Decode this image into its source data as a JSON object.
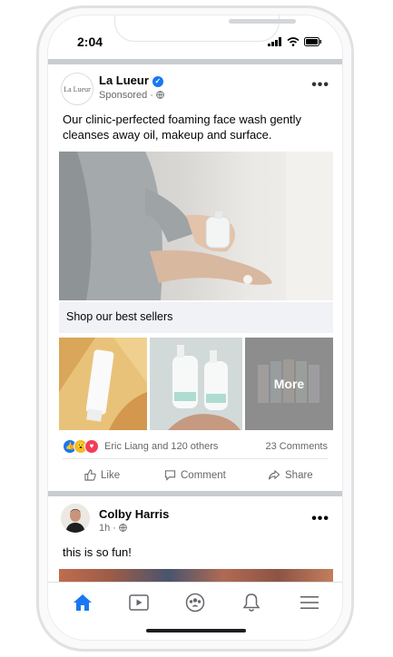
{
  "status": {
    "time": "2:04"
  },
  "post": {
    "page_name": "La Lueur",
    "logo_text": "La Lueur",
    "sponsored_label": "Sponsored",
    "text": "Our clinic-perfected foaming face wash gently cleanses away oil, makeup and surface.",
    "banner": "Shop our best sellers",
    "more_label": "More",
    "reactions_text": "Eric Liang and 120 others",
    "comments_text": "23 Comments",
    "actions": {
      "like": "Like",
      "comment": "Comment",
      "share": "Share"
    }
  },
  "post2": {
    "author": "Colby Harris",
    "time": "1h",
    "text": "this is so fun!"
  },
  "colors": {
    "accent": "#1877f2",
    "divider": "#c9ccd1",
    "secondary_text": "#65676b"
  },
  "tabbar": {
    "items": [
      "home-icon",
      "video-icon",
      "groups-icon",
      "notifications-icon",
      "menu-icon"
    ],
    "active": "home-icon"
  }
}
